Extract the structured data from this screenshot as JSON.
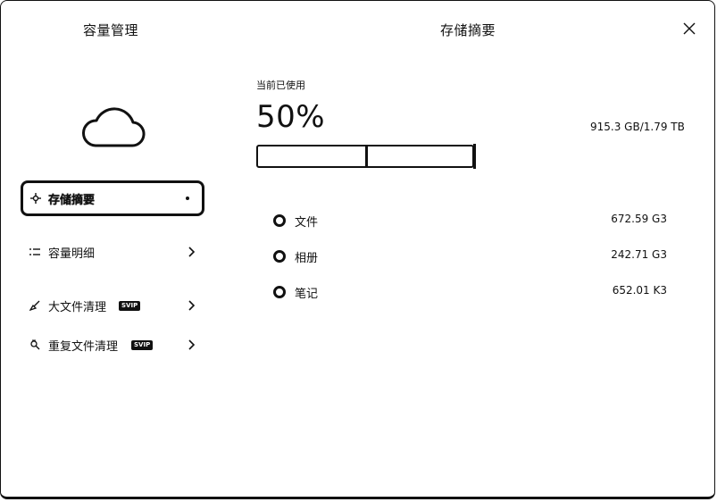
{
  "sidebar": {
    "title": "容量管理",
    "items": [
      {
        "label": "存储摘要"
      },
      {
        "label": "容量明细"
      },
      {
        "label": "大文件清理",
        "badge": "SVIP"
      },
      {
        "label": "重复文件清理",
        "badge": "SVIP"
      }
    ]
  },
  "main": {
    "title": "存储摘要",
    "used_label": "当前已使用",
    "used_percent": "50%",
    "used_fraction": 0.5,
    "used_size": "915.3 GB/1.79 TB",
    "categories": [
      {
        "name": "文件",
        "size": "672.59 G3"
      },
      {
        "name": "相册",
        "size": "242.71 G3"
      },
      {
        "name": "笔记",
        "size": "652.01 K3"
      }
    ]
  },
  "icons": {
    "close": "close-icon",
    "cloud": "cloud-icon",
    "summary": "summary-icon",
    "detail": "list-icon",
    "large": "broom-icon",
    "duplicate": "duplicate-icon",
    "chevron": "chevron-right-icon"
  }
}
